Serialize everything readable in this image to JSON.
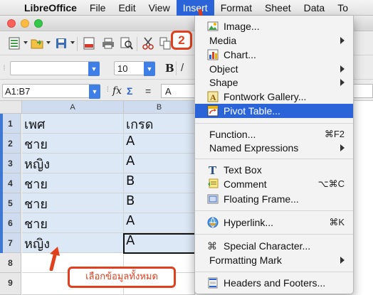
{
  "menubar": {
    "app_name": "LibreOffice",
    "items": [
      "File",
      "Edit",
      "View",
      "Insert",
      "Format",
      "Sheet",
      "Data",
      "To"
    ]
  },
  "toolbar": {
    "font_name": "",
    "font_size": "10",
    "bold_label": "B"
  },
  "formula_bar": {
    "name_box": "A1:B7",
    "fx_label": "fx",
    "sigma_label": "Σ",
    "equals_label": "=",
    "content": "A"
  },
  "sheet": {
    "columns": [
      "A",
      "B"
    ],
    "row_numbers": [
      "1",
      "2",
      "3",
      "4",
      "5",
      "6",
      "7",
      "8",
      "9"
    ],
    "rows": [
      [
        "เพศ",
        "เกรด"
      ],
      [
        "ชาย",
        "A"
      ],
      [
        "หญิง",
        "A"
      ],
      [
        "ชาย",
        "B"
      ],
      [
        "ชาย",
        "B"
      ],
      [
        "ชาย",
        "A"
      ],
      [
        "หญิง",
        "A"
      ],
      [
        "",
        ""
      ],
      [
        "",
        ""
      ]
    ]
  },
  "annotations": {
    "step_badge": "2",
    "callout": "เลือกข้อมูลทั้งหมด"
  },
  "insert_menu": {
    "items": [
      {
        "label": "Image...",
        "icon": "image-icon"
      },
      {
        "label": "Media",
        "submenu": true
      },
      {
        "label": "Chart...",
        "icon": "chart-icon"
      },
      {
        "label": "Object",
        "submenu": true
      },
      {
        "label": "Shape",
        "submenu": true
      },
      {
        "label": "Fontwork Gallery...",
        "icon": "fontwork-icon"
      },
      {
        "label": "Pivot Table...",
        "icon": "pivot-table-icon",
        "highlighted": true
      },
      {
        "label": "Function...",
        "shortcut": "⌘F2"
      },
      {
        "label": "Named Expressions",
        "submenu": true
      },
      {
        "label": "Text Box",
        "icon": "text-box-icon"
      },
      {
        "label": "Comment",
        "icon": "comment-icon",
        "shortcut": "⌥⌘C"
      },
      {
        "label": "Floating Frame...",
        "icon": "floating-frame-icon"
      },
      {
        "label": "Hyperlink...",
        "icon": "hyperlink-icon",
        "shortcut": "⌘K"
      },
      {
        "label": "Special Character...",
        "icon": "special-character-icon"
      },
      {
        "label": "Formatting Mark",
        "submenu": true
      },
      {
        "label": "Headers and Footers...",
        "icon": "headers-footers-icon"
      }
    ]
  },
  "colors": {
    "menu_highlight": "#2a64d8",
    "selection": "#dde8f6",
    "annotation": "#e0401e"
  }
}
